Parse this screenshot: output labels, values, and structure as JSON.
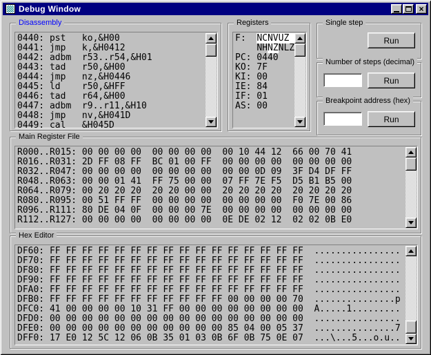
{
  "window": {
    "title": "Debug Window"
  },
  "titlebar": {
    "close_glyph": "×"
  },
  "colors": {
    "titlebar": "#000080",
    "window_bg": "#c0c0c0",
    "disassembly_label": "#0000ff",
    "highlight": "#ffffff"
  },
  "disassembly": {
    "label": "Disassembly",
    "lines": [
      "0440: pst   ko,&H00",
      "0441: jmp   k,&H0412",
      "0442: adbm  r53..r54,&H01",
      "0443: tad   r50,&H00",
      "0444: jmp   nz,&H0446",
      "0445: ld    r50,&HFF",
      "0446: tad   r64,&H00",
      "0447: adbm  r9..r11,&H10",
      "0448: jmp   nv,&H041D",
      "0449: cal   &H045D"
    ]
  },
  "registers": {
    "label": "Registers",
    "flags_row1": {
      "prefix": "F:  ",
      "highlight": "NCNVUZ "
    },
    "flags_row2": {
      "indent": "    ",
      "pre": "NH",
      "highlight": "NZ",
      "post": "NLZ"
    },
    "lines": [
      "PC: 0440",
      "KO: 7F",
      "KI: 00",
      "IE: 84",
      "IF: 01",
      "AS: 00"
    ]
  },
  "single_step": {
    "label": "Single step",
    "run_label": "Run"
  },
  "number_of_steps": {
    "label": "Number of steps (decimal)",
    "run_label": "Run",
    "input_value": ""
  },
  "breakpoint": {
    "label": "Breakpoint address (hex)",
    "run_label": "Run",
    "input_value": ""
  },
  "main_register_file": {
    "label": "Main Register File",
    "lines": [
      "R000..R015: 00 00 00 00  00 00 00 00  00 10 44 12  66 00 70 41",
      "R016..R031: 2D FF 08 FF  BC 01 00 FF  00 00 00 00  00 00 00 00",
      "R032..R047: 00 00 00 00  00 00 00 00  00 00 0D 09  3F D4 DF FF",
      "R048..R063: 00 00 01 41  FF 75 00 00  07 FF 7E F5  D5 B1 B5 00",
      "R064..R079: 00 20 20 20  20 20 00 00  20 20 20 20  20 20 20 20",
      "R080..R095: 00 51 FF FF  00 00 00 00  00 00 00 00  F0 7E 00 86",
      "R096..R111: 80 DE 04 0F  00 00 00 7E  00 00 00 00  00 00 00 00",
      "R112..R127: 00 00 00 00  00 00 00 00  0E DE 02 12  02 02 0B E0"
    ]
  },
  "hex_editor": {
    "label": "Hex Editor",
    "lines": [
      "DF60: FF FF FF FF FF FF FF FF FF FF FF FF FF FF FF FF  ................",
      "DF70: FF FF FF FF FF FF FF FF FF FF FF FF FF FF FF FF  ................",
      "DF80: FF FF FF FF FF FF FF FF FF FF FF FF FF FF FF FF  ................",
      "DF90: FF FF FF FF FF FF FF FF FF FF FF FF FF FF FF FF  ................",
      "DFA0: FF FF FF FF FF FF FF FF FF FF FF FF FF FF FF FF  ................",
      "DFB0: FF FF FF FF FF FF FF FF FF FF FF 00 00 00 00 70  ...............p",
      "DFC0: 41 00 00 00 00 10 31 FF 00 00 00 00 00 00 00 00  A.....1.........",
      "DFD0: 00 00 00 00 00 00 00 00 00 00 00 00 00 00 00 00  ................",
      "DFE0: 00 00 00 00 00 00 00 00 00 00 00 85 04 00 05 37  ...............7",
      "DFF0: 17 E0 12 5C 12 06 0B 35 01 03 0B 6F 0B 75 0E 07  ...\\...5...o.u.."
    ]
  }
}
